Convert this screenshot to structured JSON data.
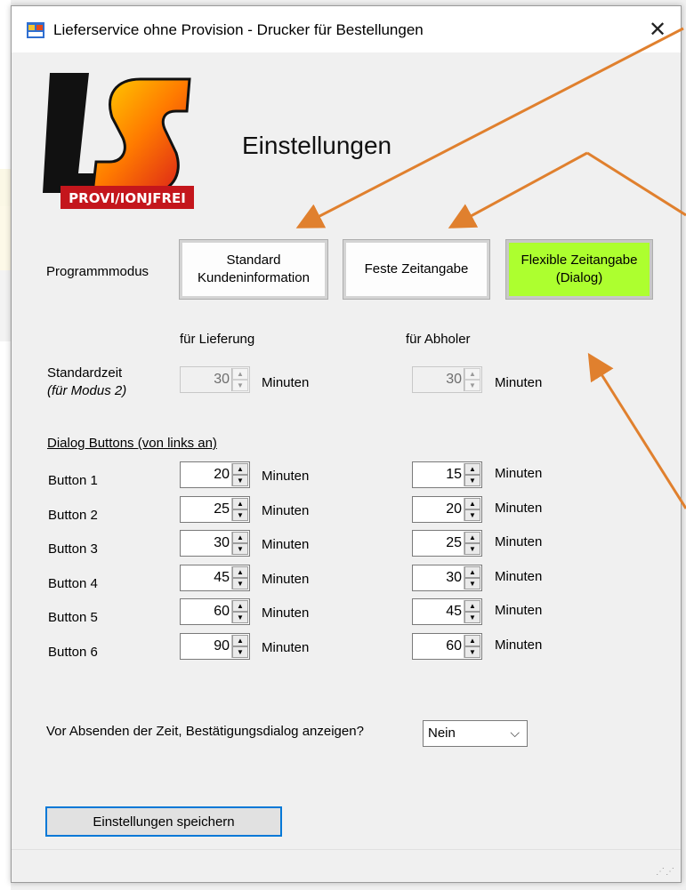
{
  "window": {
    "title": "Lieferservice ohne Provision - Drucker für Bestellungen",
    "close": "✕"
  },
  "logo": {
    "letters": "LS",
    "tagline": "PROVI/IONJFREI"
  },
  "heading": "Einstellungen",
  "mode": {
    "label": "Programmmodus",
    "buttons": [
      {
        "label": "Standard\nKundeninformation",
        "active": false
      },
      {
        "label": "Feste Zeitangabe",
        "active": false
      },
      {
        "label": "Flexible Zeitangabe\n(Dialog)",
        "active": true
      }
    ]
  },
  "columns": {
    "delivery": "für Lieferung",
    "pickup": "für Abholer"
  },
  "standard": {
    "label": "Standardzeit",
    "sublabel": "(für Modus 2)",
    "delivery_value": "30",
    "pickup_value": "30",
    "unit": "Minuten"
  },
  "dialog_buttons": {
    "heading": "Dialog Buttons (von links an)",
    "unit": "Minuten",
    "rows": [
      {
        "label": "Button 1",
        "delivery": "20",
        "pickup": "15"
      },
      {
        "label": "Button 2",
        "delivery": "25",
        "pickup": "20"
      },
      {
        "label": "Button 3",
        "delivery": "30",
        "pickup": "25"
      },
      {
        "label": "Button 4",
        "delivery": "45",
        "pickup": "30"
      },
      {
        "label": "Button 5",
        "delivery": "60",
        "pickup": "45"
      },
      {
        "label": "Button 6",
        "delivery": "90",
        "pickup": "60"
      }
    ]
  },
  "confirm": {
    "question": "Vor Absenden der Zeit, Bestätigungsdialog anzeigen?",
    "value": "Nein"
  },
  "save_label": "Einstellungen speichern",
  "colors": {
    "accent_green": "#adff2f",
    "arrow": "#e0802e",
    "focus_blue": "#0078d7"
  }
}
